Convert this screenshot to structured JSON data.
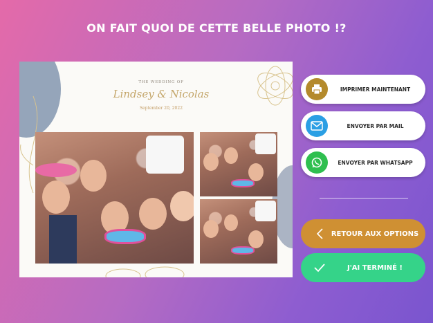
{
  "page": {
    "title": "ON FAIT QUOI DE CETTE BELLE PHOTO !?"
  },
  "photo": {
    "header_top": "THE WEDDING OF",
    "names": "Lindsey & Nicolas",
    "date": "September 20, 2022"
  },
  "actions": {
    "print_label": "IMPRIMER MAINTENANT",
    "mail_label": "ENVOYER PAR MAIL",
    "whatsapp_label": "ENVOYER PAR WHATSAPP",
    "back_label": "RETOUR AUX OPTIONS",
    "done_label": "J'AI TERMINÉ !"
  },
  "colors": {
    "print_icon_bg": "#b48a2c",
    "mail_icon_bg": "#2b9fe4",
    "whatsapp_icon_bg": "#2fbf4f",
    "back_button_bg": "#cf9033",
    "done_button_bg": "#35d389"
  },
  "icons": {
    "print": "printer-icon",
    "mail": "mail-icon",
    "whatsapp": "whatsapp-icon",
    "back": "chevron-left-icon",
    "done": "check-icon"
  }
}
